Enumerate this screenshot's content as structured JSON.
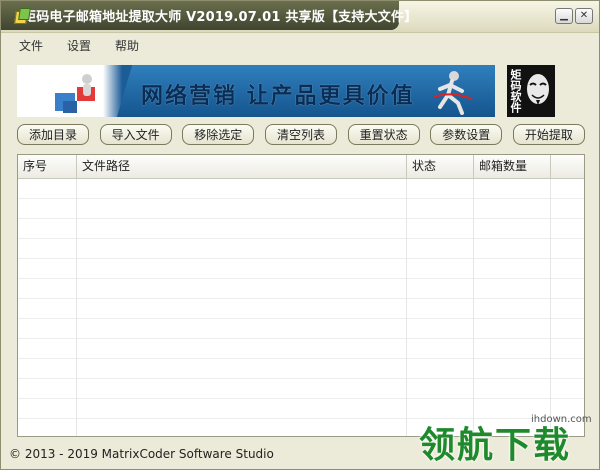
{
  "window": {
    "title": "矩码电子邮箱地址提取大师 V2019.07.01 共享版【支持大文件】",
    "min_icon": "minimize-icon",
    "close_icon": "close-icon"
  },
  "menu": [
    "文件",
    "设置",
    "帮助"
  ],
  "banner": {
    "text": "网络营销  让产品更具价值"
  },
  "logo": {
    "text": "矩码软件"
  },
  "toolbar": [
    "添加目录",
    "导入文件",
    "移除选定",
    "清空列表",
    "重置状态",
    "参数设置",
    "开始提取"
  ],
  "table": {
    "columns": [
      "序号",
      "文件路径",
      "状态",
      "邮箱数量"
    ],
    "rows": []
  },
  "status": {
    "text": "© 2013 - 2019  MatrixCoder Software Studio"
  },
  "watermark": {
    "site": "ihdown.com",
    "brand": "领航下载"
  }
}
